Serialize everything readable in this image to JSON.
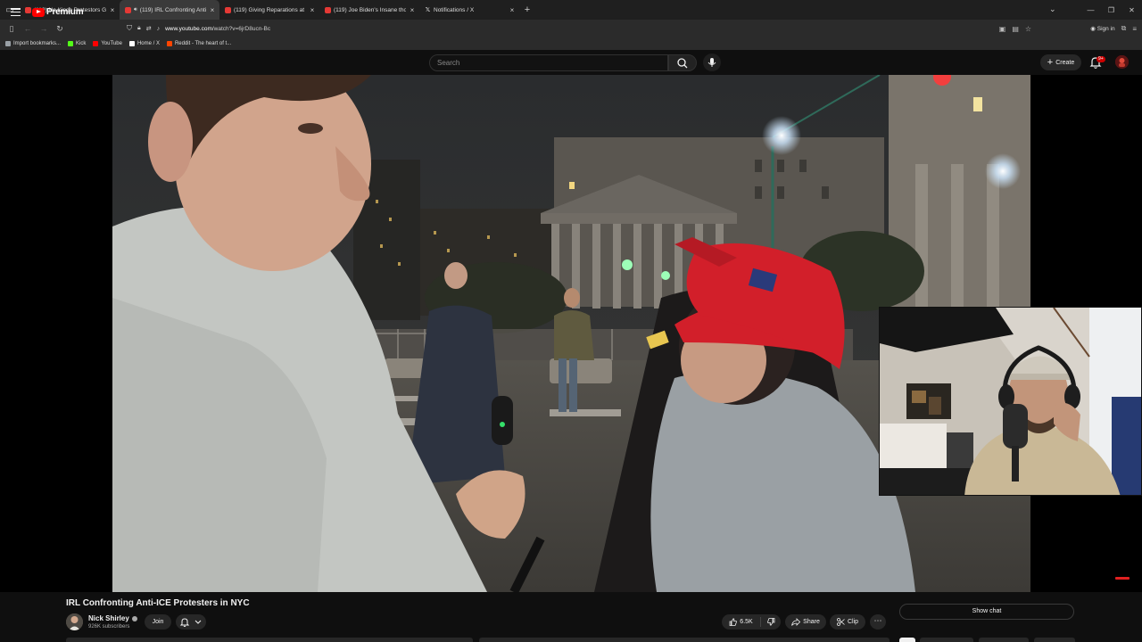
{
  "browser": {
    "tabs": [
      {
        "title": "(119) No Kings Protestors Go C",
        "favicon": "youtube-icon",
        "active": false
      },
      {
        "title": "(119) IRL Confronting Anti-",
        "favicon": "youtube-icon",
        "active": true,
        "audio": true
      },
      {
        "title": "(119) Giving Reparations at No",
        "favicon": "youtube-icon",
        "active": false
      },
      {
        "title": "(119) Joe Biden's Insane thoug",
        "favicon": "youtube-icon",
        "active": false
      },
      {
        "title": "Notifications / X",
        "favicon": "x-icon",
        "active": false
      }
    ],
    "url": "www.youtube.com/watch?v=6jrD8ucn-Bc",
    "url_host": "www.youtube.com",
    "url_path": "/watch?v=6jrD8ucn-Bc",
    "sign_in_label": "Sign in",
    "bookmarks": [
      {
        "label": "Import bookmarks...",
        "icon": "import-icon",
        "color": "#9aa0a6"
      },
      {
        "label": "Kick",
        "icon": "kick-icon",
        "color": "#53fc18"
      },
      {
        "label": "YouTube",
        "icon": "youtube-icon",
        "color": "#ff0000"
      },
      {
        "label": "Home / X",
        "icon": "x-icon",
        "color": "#ffffff"
      },
      {
        "label": "Reddit - The heart of t...",
        "icon": "reddit-icon",
        "color": "#ff4500"
      }
    ]
  },
  "youtube": {
    "logo_text": "Premium",
    "search_placeholder": "Search",
    "create_label": "Create",
    "notification_badge": "9+"
  },
  "video": {
    "title": "IRL Confronting Anti-ICE Protesters in NYC",
    "channel": "Nick Shirley",
    "subscribers": "926K subscribers",
    "join_label": "Join",
    "likes": "6.5K",
    "share_label": "Share",
    "clip_label": "Clip",
    "show_chat_label": "Show chat"
  },
  "colors": {
    "brand_red": "#ff0000",
    "background": "#0f0f0f",
    "pill": "#272727",
    "cap_red": "#d21f2a"
  }
}
